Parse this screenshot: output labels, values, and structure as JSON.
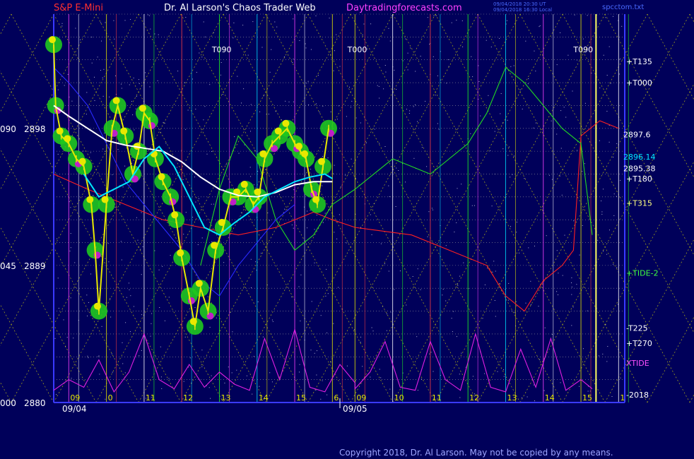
{
  "header": {
    "symbol": "S&P E-Mini",
    "title": "Dr. Al Larson's Chaos Trader Web",
    "site": "Daytradingforecasts.com",
    "stamp_line1": "09/04/2018 20:30 UT",
    "stamp_line2": "09/04/2018 16:30 Local",
    "stamp_right": "spcctom.txt"
  },
  "footer": {
    "copyright": "Copyright 2018, Dr. Al Larson. May not be copied by any means."
  },
  "colors": {
    "background": "#00005a",
    "grid": "#9a9a9a",
    "yellow_grid": "#e8e800",
    "price_bars": "#e8e800",
    "bubble_green": "#1fc81f",
    "bubble_magenta": "#c01fc8",
    "white_avg": "#ffffff",
    "cyan_avg": "#00e8ff",
    "axis": "#3a3aff",
    "red_field": "#ff2020",
    "green_field": "#22d822",
    "blue_field": "#2a2aff",
    "xtide": "#e01fe0"
  },
  "chart_data": {
    "type": "line",
    "title": "",
    "xlabel": "",
    "ylabel": "",
    "ylim": [
      2880,
      2905.5
    ],
    "xlim": [
      8.6,
      16.2
    ],
    "y_ticks": [
      {
        "value": 2898,
        "angle": "090",
        "price": "2898"
      },
      {
        "value": 2889,
        "angle": "045",
        "price": "2889"
      },
      {
        "value": 2880,
        "angle": "000",
        "price": "2880"
      }
    ],
    "x_ticks": [
      {
        "value": 9,
        "label": "09"
      },
      {
        "value": 10,
        "label": "0"
      },
      {
        "value": 11,
        "label": "11"
      },
      {
        "value": 12,
        "label": "12"
      },
      {
        "value": 13,
        "label": "13"
      },
      {
        "value": 14,
        "label": "14"
      },
      {
        "value": 15,
        "label": "15"
      },
      {
        "value": 16,
        "label": "6"
      },
      {
        "value": 9,
        "label": "09",
        "day": 2
      },
      {
        "value": 10,
        "label": "10",
        "day": 2
      },
      {
        "value": 11,
        "label": "11",
        "day": 2
      },
      {
        "value": 12,
        "label": "12",
        "day": 2
      },
      {
        "value": 13,
        "label": "13",
        "day": 2
      },
      {
        "value": 14,
        "label": "14",
        "day": 2
      },
      {
        "value": 15,
        "label": "15",
        "day": 2
      },
      {
        "value": 16,
        "label": "1",
        "day": 2
      }
    ],
    "date_labels": [
      {
        "x": 8.75,
        "label": "09/04"
      },
      {
        "x": 16.2,
        "label": "09/05"
      }
    ],
    "price_series": {
      "name": "",
      "x": [
        8.6,
        8.65,
        8.8,
        9.0,
        9.2,
        9.4,
        9.6,
        9.7,
        9.8,
        10.0,
        10.15,
        10.3,
        10.5,
        10.7,
        10.85,
        11.0,
        11.15,
        11.3,
        11.5,
        11.7,
        11.85,
        12.0,
        12.2,
        12.35,
        12.5,
        12.7,
        12.9,
        13.1,
        13.3,
        13.5,
        13.7,
        13.9,
        14.05,
        14.2,
        14.4,
        14.6,
        14.8,
        15.0,
        15.15,
        15.3,
        15.45,
        15.6,
        15.75,
        15.9
      ],
      "y": [
        2903.5,
        2899.5,
        2897.5,
        2897.0,
        2896.0,
        2895.5,
        2893.0,
        2890.0,
        2886.0,
        2893.0,
        2898.0,
        2899.5,
        2897.5,
        2895.0,
        2896.5,
        2899.0,
        2898.5,
        2896.0,
        2894.5,
        2893.5,
        2892.0,
        2889.5,
        2887.0,
        2885.0,
        2887.5,
        2886.0,
        2890.0,
        2891.5,
        2893.5,
        2893.5,
        2894.0,
        2893.0,
        2893.5,
        2896.0,
        2897.0,
        2897.5,
        2898.0,
        2897.0,
        2896.5,
        2896.0,
        2894.0,
        2893.0,
        2895.5,
        2898.0
      ]
    },
    "white_avg": {
      "name": "",
      "x": [
        8.6,
        9.0,
        9.5,
        10.0,
        10.5,
        11.0,
        11.5,
        12.0,
        12.5,
        13.0,
        13.5,
        14.0,
        14.5,
        15.0,
        15.5,
        16.0
      ],
      "y": [
        2899.5,
        2898.8,
        2898.0,
        2897.2,
        2896.9,
        2896.7,
        2896.5,
        2895.8,
        2894.8,
        2894.0,
        2893.6,
        2893.5,
        2893.8,
        2894.3,
        2894.5,
        2894.5
      ]
    },
    "cyan_avg": {
      "name": "",
      "x": [
        9.4,
        9.8,
        10.2,
        10.6,
        11.0,
        11.4,
        11.8,
        12.2,
        12.6,
        13.0,
        13.4,
        13.8,
        14.2,
        14.6,
        15.0,
        15.4,
        15.8,
        16.0
      ],
      "y": [
        2895.0,
        2893.5,
        2894.0,
        2894.5,
        2896.0,
        2896.8,
        2895.5,
        2893.5,
        2891.5,
        2891.0,
        2891.8,
        2892.5,
        2893.5,
        2894.0,
        2894.5,
        2894.8,
        2895.0,
        2894.7
      ]
    },
    "field_lines": [
      {
        "name": "",
        "color": "#ff2020",
        "x": [
          8.6,
          9.5,
          10.5,
          11.5,
          12.5,
          13.5,
          14.5,
          15.0,
          15.5,
          16.0,
          17.0,
          18.5,
          19.5,
          20.5,
          21.0,
          21.5,
          22.0,
          22.5,
          22.8,
          23.0,
          23.5,
          24.0
        ],
        "y": [
          2895,
          2894,
          2893,
          2892,
          2891.5,
          2891,
          2891.5,
          2892,
          2892.5,
          2892,
          2891.5,
          2891,
          2890,
          2889,
          2887,
          2886,
          2888,
          2889,
          2890,
          2897.5,
          2898.5,
          2898
        ]
      },
      {
        "name": "",
        "color": "#22d822",
        "x": [
          12.5,
          13.0,
          13.5,
          14.0,
          14.5,
          15.0,
          15.5,
          16.0,
          17.0,
          18.0,
          19.0,
          20.0,
          20.5,
          21.0,
          21.5,
          22.0,
          22.5,
          23.0,
          23.3
        ],
        "y": [
          2889,
          2894,
          2897.5,
          2896,
          2892,
          2890,
          2891,
          2893,
          2894,
          2896,
          2895,
          2897,
          2899,
          2902,
          2901,
          2899.5,
          2898,
          2897,
          2891
        ]
      },
      {
        "name": "",
        "color": "#2a2aff",
        "x": [
          8.6,
          9.0,
          9.5,
          10.0,
          10.5,
          11.0,
          11.5,
          12.0,
          12.5,
          13.0,
          13.5,
          14.0,
          14.5,
          15.0
        ],
        "y": [
          2902,
          2901,
          2899.5,
          2897,
          2894.5,
          2893,
          2891.5,
          2890,
          2888,
          2887,
          2889,
          2890.5,
          2892,
          2893
        ]
      }
    ],
    "xtide": {
      "name": "XTIDE",
      "x": [
        8.6,
        9.0,
        9.4,
        9.8,
        10.2,
        10.6,
        11.0,
        11.4,
        11.8,
        12.2,
        12.6,
        13.0,
        13.4,
        13.8,
        14.2,
        14.6,
        15.0,
        15.4,
        15.8,
        16.2,
        16.6,
        17.0,
        17.4,
        17.8,
        18.2,
        18.6,
        19.0,
        19.4,
        19.8,
        20.2,
        20.6,
        21.0,
        21.4,
        21.8,
        22.2,
        22.6,
        23.0,
        23.3
      ],
      "y": [
        2880.8,
        2881.5,
        2881.0,
        2882.8,
        2880.7,
        2882.0,
        2884.5,
        2881.5,
        2880.9,
        2882.5,
        2881.0,
        2882.0,
        2881.2,
        2880.8,
        2884.2,
        2881.5,
        2884.8,
        2881.0,
        2880.7,
        2882.5,
        2881.3,
        2880.9,
        2882.0,
        2884.0,
        2881.0,
        2880.8,
        2884.0,
        2881.5,
        2880.8,
        2884.5,
        2881.0,
        2880.7,
        2883.5,
        2881.0,
        2884.2,
        2880.8,
        2881.5,
        2880.9
      ]
    },
    "price_labels": [
      {
        "y": 2897.6,
        "text": "2897.6"
      },
      {
        "y": 2896.14,
        "text": "2896.14",
        "color": "#00e8ff"
      },
      {
        "y": 2895.38,
        "text": "2895.38"
      }
    ],
    "right_labels": [
      {
        "y": 2902.4,
        "text": "+T135"
      },
      {
        "y": 2901.0,
        "text": "+T000"
      },
      {
        "y": 2894.7,
        "text": "+T180"
      },
      {
        "y": 2893.1,
        "text": "+T315",
        "color": "#ffff80"
      },
      {
        "y": 2888.5,
        "text": "+TIDE-2",
        "color": "#40ff40"
      },
      {
        "y": 2884.9,
        "text": "-T225"
      },
      {
        "y": 2883.9,
        "text": "+T270"
      },
      {
        "y": 2882.6,
        "text": "XTIDE",
        "color": "#ff50ff"
      },
      {
        "y": 2880.5,
        "text": "-2018"
      }
    ],
    "vertical_labels": [
      {
        "x": 12.8,
        "text": "T090"
      },
      {
        "x": 16.8,
        "text": "T000"
      },
      {
        "x": 22.8,
        "text": "T090"
      }
    ]
  }
}
